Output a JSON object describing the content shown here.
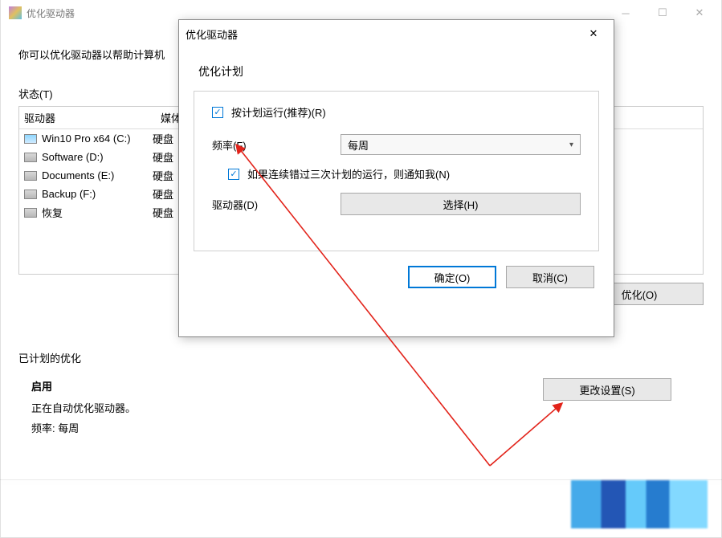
{
  "main": {
    "title": "优化驱动器",
    "intro": "你可以优化驱动器以帮助计算机",
    "status_label": "状态(T)",
    "columns": {
      "drive": "驱动器",
      "media": "媒体"
    },
    "drives": [
      {
        "name": "Win10 Pro x64 (C:)",
        "media": "硬盘",
        "sys": true
      },
      {
        "name": "Software (D:)",
        "media": "硬盘",
        "sys": false
      },
      {
        "name": "Documents (E:)",
        "media": "硬盘",
        "sys": false
      },
      {
        "name": "Backup (F:)",
        "media": "硬盘",
        "sys": false
      },
      {
        "name": "恢复",
        "media": "硬盘",
        "sys": false
      }
    ],
    "optimize_btn": "优化(O)",
    "scheduled": {
      "section_label": "已计划的优化",
      "enabled_label": "启用",
      "line1": "正在自动优化驱动器。",
      "line2": "频率: 每周",
      "change_btn": "更改设置(S)"
    }
  },
  "dialog": {
    "title": "优化驱动器",
    "heading": "优化计划",
    "run_on_schedule": "按计划运行(推荐)(R)",
    "frequency_label": "频率(F)",
    "frequency_value": "每周",
    "notify_label": "如果连续错过三次计划的运行，则通知我(N)",
    "drive_label": "驱动器(D)",
    "choose_btn": "选择(H)",
    "ok_btn": "确定(O)",
    "cancel_btn": "取消(C)"
  }
}
